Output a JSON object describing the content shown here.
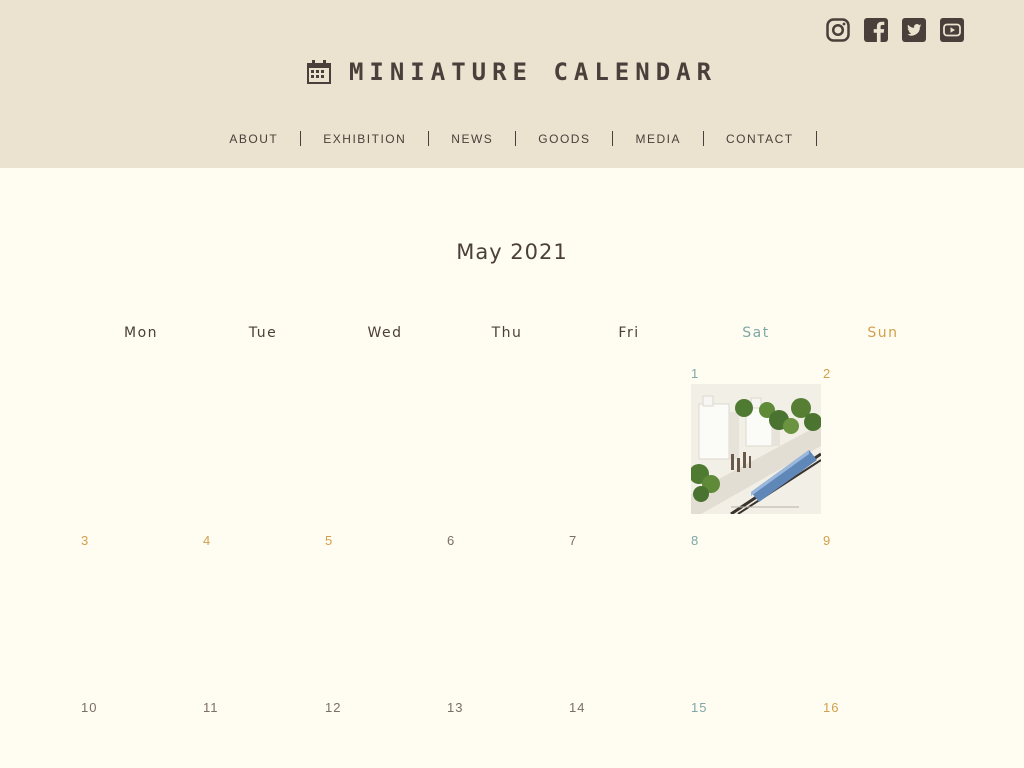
{
  "brand": {
    "title": "MINIATURE CALENDAR",
    "icon": "calendar-icon"
  },
  "social": [
    {
      "name": "instagram-icon"
    },
    {
      "name": "facebook-icon"
    },
    {
      "name": "twitter-icon"
    },
    {
      "name": "youtube-icon"
    }
  ],
  "nav": [
    "ABOUT",
    "EXHIBITION",
    "NEWS",
    "GOODS",
    "MEDIA",
    "CONTACT"
  ],
  "calendar": {
    "month_title": "May 2021",
    "weekdays": [
      "Mon",
      "Tue",
      "Wed",
      "Thu",
      "Fri",
      "Sat",
      "Sun"
    ],
    "days": [
      "1",
      "2",
      "3",
      "4",
      "5",
      "6",
      "7",
      "8",
      "9",
      "10",
      "11",
      "12",
      "13",
      "14",
      "15",
      "16"
    ],
    "holidays": [
      "3",
      "4",
      "5"
    ]
  },
  "colors": {
    "header_bg": "#ebe2cf",
    "page_bg": "#fffcf1",
    "text": "#4a3f3a",
    "saturday": "#7fa8a8",
    "sunday_holiday": "#d2a04c"
  }
}
